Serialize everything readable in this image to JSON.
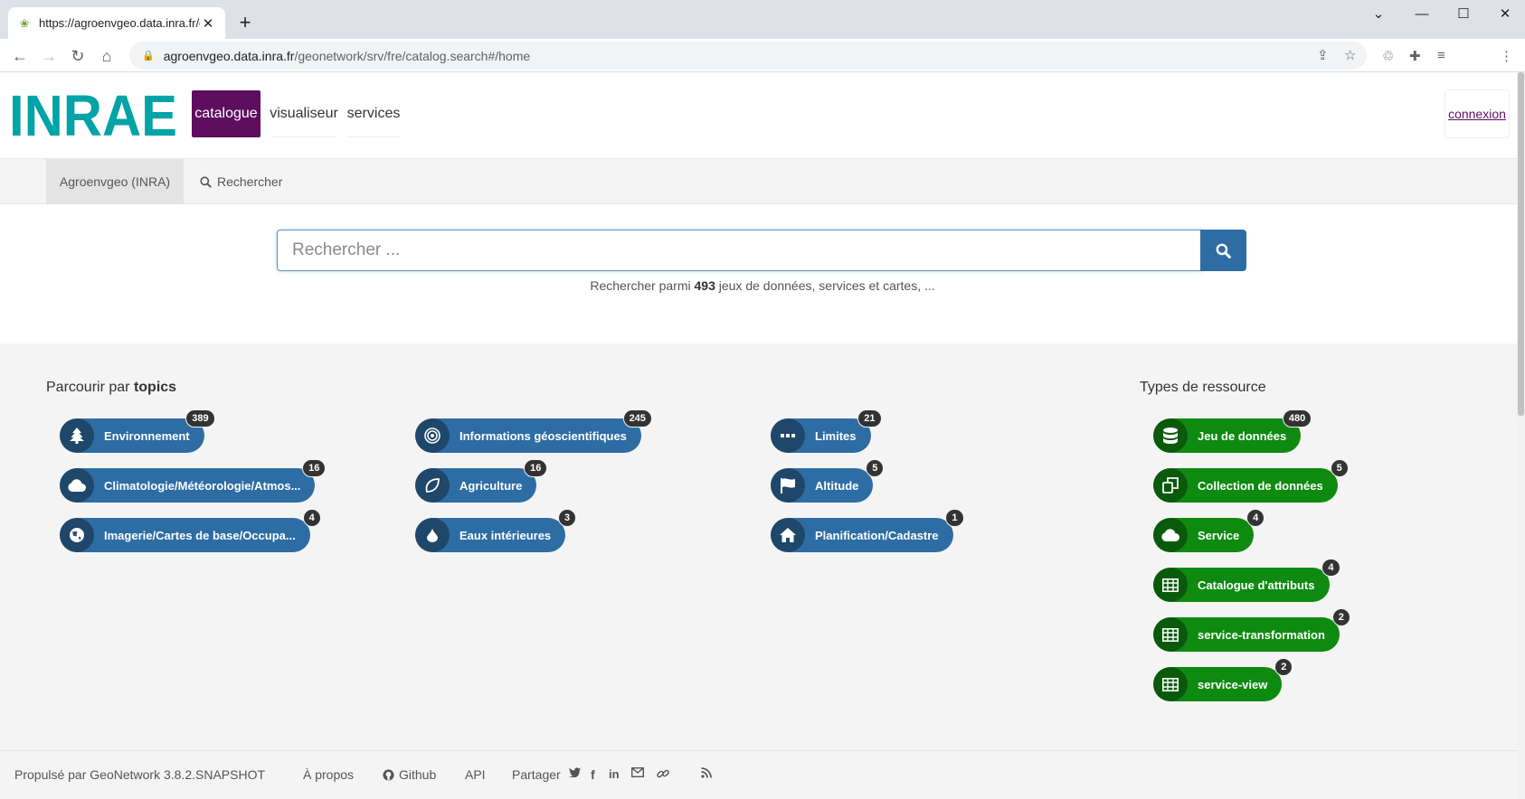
{
  "browser": {
    "tab_title": "https://agroenvgeo.data.inra.fr/g",
    "url_host": "agroenvgeo.data.inra.fr",
    "url_path": "/geonetwork/srv/fre/catalog.search#/home"
  },
  "header": {
    "logo_text": "INRAE",
    "nav": {
      "catalogue": "catalogue",
      "visualiseur": "visualiseur",
      "services": "services"
    },
    "login": "connexion"
  },
  "subnav": {
    "home": "Agroenvgeo (INRA)",
    "search": "Rechercher"
  },
  "search": {
    "placeholder": "Rechercher ...",
    "hint_prefix": "Rechercher parmi",
    "hint_count": "493",
    "hint_suffix": "jeux de données, services et cartes, ..."
  },
  "topics": {
    "title_prefix": "Parcourir par",
    "title_bold": "topics",
    "items": [
      {
        "label": "Environnement",
        "count": "389",
        "icon": "tree-icon"
      },
      {
        "label": "Climatologie/Météorologie/Atmos...",
        "count": "16",
        "icon": "cloud-icon"
      },
      {
        "label": "Imagerie/Cartes de base/Occupa...",
        "count": "4",
        "icon": "globe-icon"
      },
      {
        "label": "Informations géoscientifiques",
        "count": "245",
        "icon": "target-icon"
      },
      {
        "label": "Agriculture",
        "count": "16",
        "icon": "leaf-icon"
      },
      {
        "label": "Eaux intérieures",
        "count": "3",
        "icon": "droplet-icon"
      },
      {
        "label": "Limites",
        "count": "21",
        "icon": "dots-icon"
      },
      {
        "label": "Altitude",
        "count": "5",
        "icon": "flag-icon"
      },
      {
        "label": "Planification/Cadastre",
        "count": "1",
        "icon": "home-icon"
      }
    ]
  },
  "resource_types": {
    "title": "Types de ressource",
    "items": [
      {
        "label": "Jeu de données",
        "count": "480",
        "icon": "database-icon"
      },
      {
        "label": "Collection de données",
        "count": "5",
        "icon": "copy-icon"
      },
      {
        "label": "Service",
        "count": "4",
        "icon": "cloud-icon"
      },
      {
        "label": "Catalogue d'attributs",
        "count": "4",
        "icon": "table-icon"
      },
      {
        "label": "service-transformation",
        "count": "2",
        "icon": "table-icon"
      },
      {
        "label": "service-view",
        "count": "2",
        "icon": "table-icon"
      }
    ]
  },
  "footer": {
    "powered": "Propulsé par GeoNetwork 3.8.2.SNAPSHOT",
    "about": "À propos",
    "github": "Github",
    "api": "API",
    "share": "Partager"
  },
  "colors": {
    "brand_purple": "#5e0d5f",
    "topic_blue": "#2e6da4",
    "type_green": "#0e8a11",
    "logo_teal": "#00a3a6"
  }
}
